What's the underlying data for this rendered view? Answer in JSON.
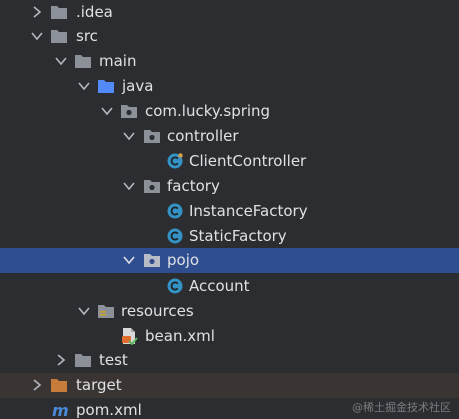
{
  "tree": {
    "items": [
      {
        "label": ".idea",
        "icon": "folder-icon",
        "expanded": false
      },
      {
        "label": "src",
        "icon": "folder-icon",
        "expanded": true
      },
      {
        "label": "main",
        "icon": "folder-icon",
        "expanded": true
      },
      {
        "label": "java",
        "icon": "source-folder-icon",
        "expanded": true
      },
      {
        "label": "com.lucky.spring",
        "icon": "package-icon",
        "expanded": true
      },
      {
        "label": "controller",
        "icon": "package-icon",
        "expanded": true
      },
      {
        "label": "ClientController",
        "icon": "java-class-icon"
      },
      {
        "label": "factory",
        "icon": "package-icon",
        "expanded": true
      },
      {
        "label": "InstanceFactory",
        "icon": "java-class-icon"
      },
      {
        "label": "StaticFactory",
        "icon": "java-class-icon"
      },
      {
        "label": "pojo",
        "icon": "package-icon",
        "expanded": true,
        "selected": true
      },
      {
        "label": "Account",
        "icon": "java-class-icon"
      },
      {
        "label": "resources",
        "icon": "resources-folder-icon",
        "expanded": true
      },
      {
        "label": "bean.xml",
        "icon": "xml-file-icon"
      },
      {
        "label": "test",
        "icon": "folder-icon",
        "expanded": false
      },
      {
        "label": "target",
        "icon": "excluded-folder-icon",
        "expanded": false
      },
      {
        "label": "pom.xml",
        "icon": "maven-icon"
      }
    ]
  },
  "watermark": "@稀土掘金技术社区",
  "colors": {
    "background": "#2b2d30",
    "selection": "#2f4e8f",
    "text": "#dfe1e5",
    "folder": "#8c9099",
    "source_folder": "#548af7",
    "java_class": "#3592c4",
    "excluded_folder": "#c77c3a",
    "maven": "#4a88d8"
  }
}
